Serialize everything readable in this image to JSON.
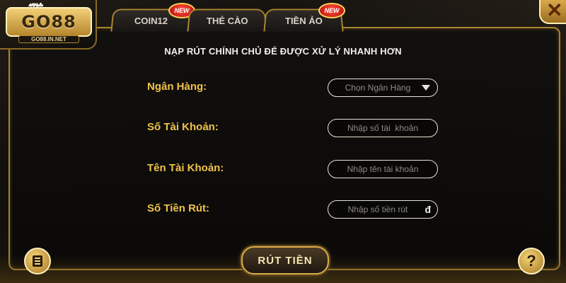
{
  "logo": {
    "brand": "GO88",
    "domain": "GO88.IN.NET",
    "cards": "♠♥♦♣"
  },
  "tabs": [
    {
      "label": "COIN12",
      "badge": "NEW"
    },
    {
      "label": "THẺ CÀO",
      "badge": ""
    },
    {
      "label": "TIỀN ẢO",
      "badge": "NEW"
    }
  ],
  "close": {
    "glyph": "✕"
  },
  "heading": "NẠP RÚT CHÍNH CHỦ ĐỂ ĐƯỢC XỬ LÝ NHANH HƠN",
  "form": {
    "bank_label": "Ngân Hàng:",
    "bank_select": "Chọn Ngân Hàng",
    "account_number_label": "Số Tài Khoản:",
    "account_number_placeholder": "Nhập số tài  khoản",
    "account_name_label": "Tên Tài Khoản:",
    "account_name_placeholder": "Nhập tên tài khoản",
    "amount_label": "Số Tiền Rút:",
    "amount_placeholder": "Nhập số tiền rút",
    "currency_symbol": "đ"
  },
  "buttons": {
    "withdraw": "RÚT TIỀN",
    "help": "?"
  },
  "icons": {
    "close": "close-icon",
    "menu": "menu-icon",
    "help": "help-icon",
    "dropdown": "chevron-down-icon"
  },
  "colors": {
    "accent_gold": "#f0c24a",
    "border_gold": "#a8842f",
    "badge_red": "#d91a12"
  }
}
